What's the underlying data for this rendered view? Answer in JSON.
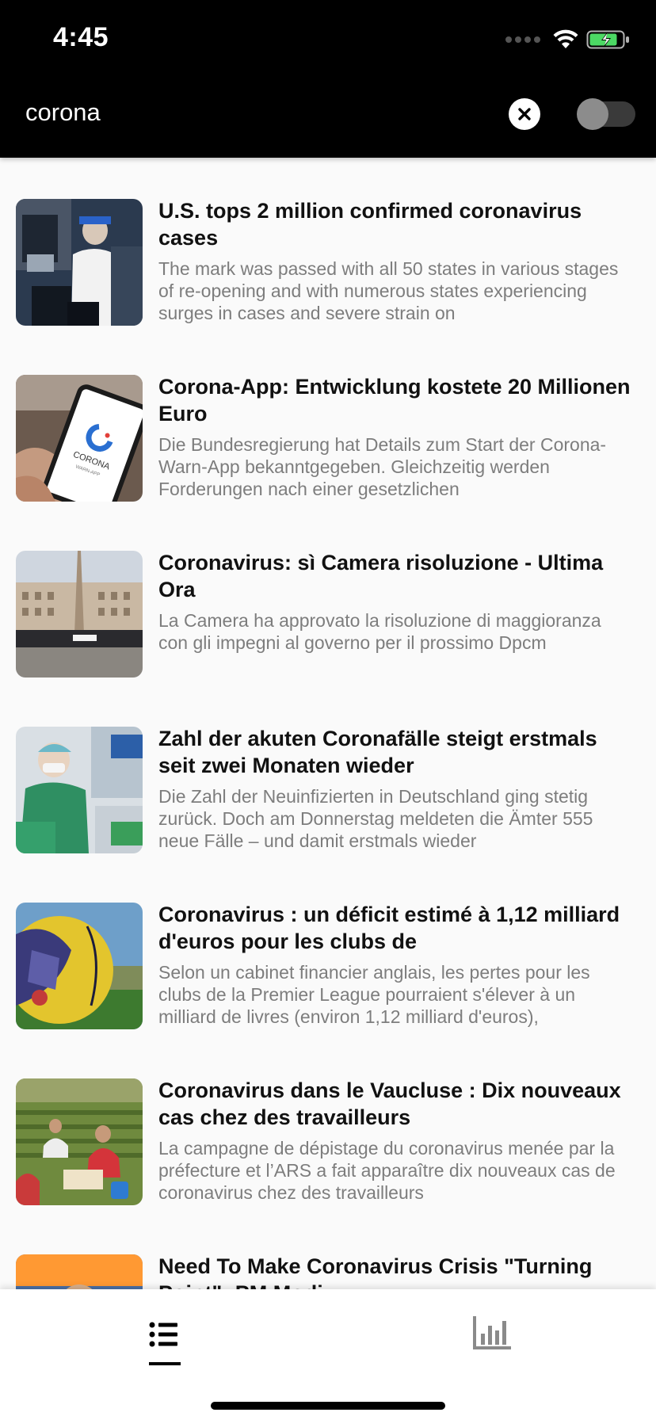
{
  "status_bar": {
    "time": "4:45"
  },
  "search": {
    "query": "corona"
  },
  "filter_toggle": {
    "on": false
  },
  "articles": [
    {
      "title": "U.S. tops 2 million confirmed coronavirus cases",
      "summary": "The mark was passed with all 50 states in various stages of re-opening and with numerous states experiencing surges in cases and severe strain on"
    },
    {
      "title": "Corona-App: Entwicklung kostete 20 Millionen Euro",
      "summary": "Die Bundesregierung hat Details zum Start der Corona-Warn-App bekanntgegeben. Gleichzeitig werden Forderungen nach einer gesetzlichen"
    },
    {
      "title": "Coronavirus: sì Camera risoluzione - Ultima Ora",
      "summary": "La Camera ha approvato la risoluzione di maggioranza con gli impegni al governo per il prossimo Dpcm"
    },
    {
      "title": "Zahl der akuten Coronafälle steigt erstmals seit zwei Monaten wieder",
      "summary": "Die Zahl der Neuinfizierten in Deutschland ging stetig zurück. Doch am Donnerstag meldeten die Ämter 555 neue Fälle – und damit erstmals wieder"
    },
    {
      "title": "Coronavirus : un déficit estimé à 1,12 milliard d'euros pour les clubs de",
      "summary": "Selon un cabinet financier anglais, les pertes pour les clubs de la Premier League pourraient s'élever à un milliard de livres (environ 1,12 milliard d'euros),"
    },
    {
      "title": "Coronavirus dans le Vaucluse : Dix nouveaux cas chez des travailleurs",
      "summary": "La campagne de dépistage du coronavirus menée par la préfecture et l’ARS a fait apparaître dix nouveaux cas de coronavirus chez des travailleurs"
    },
    {
      "title": "Need To Make Coronavirus Crisis \"Turning Point\": PM Modi",
      "summary": ""
    }
  ],
  "thumbnail_text": {
    "corona_app": "CORONA",
    "corona_app_sub": "WARN-APP"
  },
  "bottom_nav": {
    "tabs": [
      {
        "icon": "list-icon",
        "selected": true
      },
      {
        "icon": "bar-chart-icon",
        "selected": false
      }
    ]
  },
  "colors": {
    "header_bg": "#000000",
    "list_bg": "#fafafa",
    "title_text": "#111111",
    "summary_text": "#7d7d7d",
    "battery_green": "#4cd964"
  }
}
